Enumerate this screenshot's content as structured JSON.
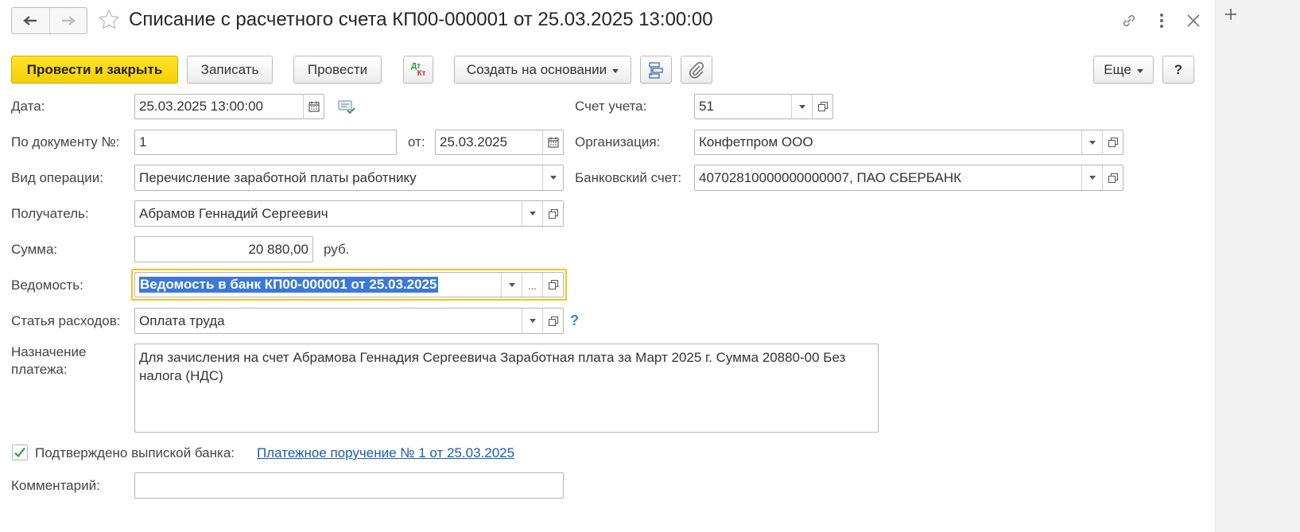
{
  "window": {
    "title": "Списание с расчетного счета КП00-000001 от 25.03.2025 13:00:00",
    "icons": [
      "back-arrow-icon",
      "forward-arrow-icon",
      "favorite-star-icon",
      "link-icon",
      "more-vertical-icon",
      "close-icon",
      "plus-icon"
    ]
  },
  "toolbar": {
    "post_close": "Провести и закрыть",
    "save": "Записать",
    "post": "Провести",
    "dt_kt_top": "Дт",
    "dt_kt_bottom": "Кт",
    "create_based": "Создать на основании",
    "more": "Еще",
    "help": "?"
  },
  "form": {
    "date": {
      "label": "Дата:",
      "value": "25.03.2025 13:00:00"
    },
    "doc_no": {
      "label": "По документу №:",
      "value": "1"
    },
    "doc_from": {
      "label": "от:",
      "value": "25.03.2025"
    },
    "operation": {
      "label": "Вид операции:",
      "value": "Перечисление заработной платы работнику"
    },
    "recipient": {
      "label": "Получатель:",
      "value": "Абрамов Геннадий Сергеевич"
    },
    "amount": {
      "label": "Сумма:",
      "value": "20 880,00",
      "currency": "руб."
    },
    "statement": {
      "label": "Ведомость:",
      "value": "Ведомость в банк КП00-000001 от 25.03.2025",
      "ellipsis": "..."
    },
    "expense_item": {
      "label": "Статья расходов:",
      "value": "Оплата труда",
      "help": "?"
    },
    "purpose": {
      "label_line1": "Назначение",
      "label_line2": "платежа:",
      "value": "Для зачисления на счет Абрамова Геннадия Сергеевича Заработная плата за Март 2025 г. Сумма 20880-00 Без налога (НДС)"
    },
    "confirmed": {
      "label": "Подтверждено выпиской банка:",
      "checked": true,
      "link": "Платежное поручение № 1 от 25.03.2025"
    },
    "comment": {
      "label": "Комментарий:",
      "value": ""
    },
    "account": {
      "label": "Счет учета:",
      "value": "51"
    },
    "organization": {
      "label": "Организация:",
      "value": "Конфетпром ООО"
    },
    "bank_account": {
      "label": "Банковский счет:",
      "value": "40702810000000000007, ПАО СБЕРБАНК"
    }
  },
  "colors": {
    "primary_button": "#f4d000",
    "focus_frame": "#f5c518",
    "selection": "#3c78d8",
    "link": "#1b5bb3",
    "help": "#2a8ad6"
  }
}
